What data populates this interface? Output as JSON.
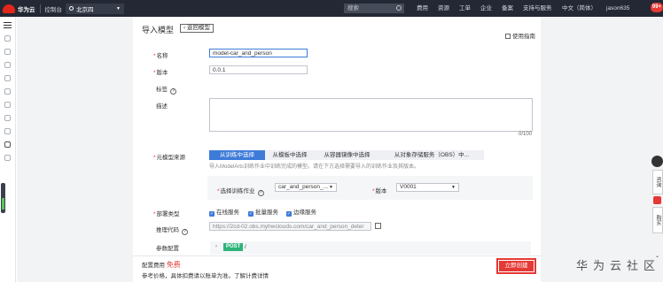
{
  "topbar": {
    "brand": "华为云",
    "console": "控制台",
    "region": "北京四",
    "search_placeholder": "搜索",
    "nav": [
      "费用",
      "资源",
      "工单",
      "企业",
      "备案",
      "支持与服务",
      "中文（简体）",
      "jason635"
    ],
    "badge": "99+"
  },
  "page": {
    "title": "导入模型",
    "back_label": "返回模型",
    "guide_label": "使用指南"
  },
  "form": {
    "name_label": "名称",
    "name_value": "model-car_and_person",
    "version_label": "版本",
    "version_value": "0.0.1",
    "tag_label": "标签",
    "desc_label": "描述",
    "desc_count": "0/100",
    "source_label": "元模型来源",
    "source_tabs": [
      "从训练中选择",
      "从模板中选择",
      "从容器镜像中选择",
      "从对象存储服务（OBS）中..."
    ],
    "source_hint": "导入ModelArts训练作业中训练完成的模型。请在下方选择需要导入的训练作业及其版本。",
    "job_label": "选择训练作业",
    "job_value": "car_and_person_...",
    "job_version_label": "版本",
    "job_version_value": "V0001",
    "deploy_label": "部署类型",
    "deploy_options": [
      "在线服务",
      "批量服务",
      "边缘服务"
    ],
    "infer_label": "推理代码",
    "infer_value": "https://2cd-02.obs.myhwclouds.com/car_and_person_deter",
    "param_label": "参数配置",
    "post_method": "POST",
    "post_path": "/"
  },
  "bottom": {
    "fee_label": "配置费用",
    "fee_value": "免费",
    "note_prefix": "参考价格，具体扣费请以账单为准。",
    "note_link": "了解计费详情",
    "create_label": "立即创建"
  },
  "watermark": "华为云社区",
  "right_widgets": [
    "咨询",
    "购买"
  ],
  "colors": {
    "accent": "#3d7bd9",
    "danger": "#e53935",
    "topbar": "#232834",
    "post": "#2db479"
  }
}
